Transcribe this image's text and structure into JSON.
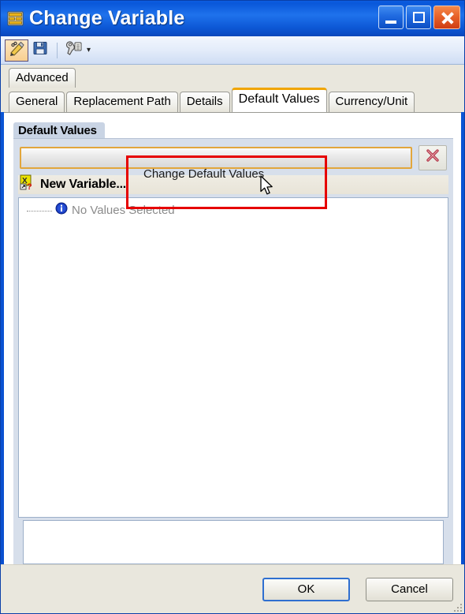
{
  "window": {
    "title": "Change Variable",
    "title_icon": "variable-window-icon",
    "controls": {
      "minimize": "Minimize",
      "maximize": "Maximize",
      "close": "Close"
    },
    "accent_titlebar": "#0d58d6",
    "accent_close": "#e8632a"
  },
  "toolbar": {
    "items": [
      {
        "name": "edit-pencil-icon",
        "label": "Edit",
        "active": true
      },
      {
        "name": "save-floppy-icon",
        "label": "Save",
        "active": false
      },
      {
        "name": "tools-wrench-icon",
        "label": "Tools",
        "active": false
      }
    ],
    "dropdown_arrow": "▾"
  },
  "tabs": {
    "row1": [
      {
        "label": "Advanced",
        "selected": false
      }
    ],
    "row2": [
      {
        "label": "General",
        "selected": false
      },
      {
        "label": "Replacement Path",
        "selected": false
      },
      {
        "label": "Details",
        "selected": false
      },
      {
        "label": "Default Values",
        "selected": true
      },
      {
        "label": "Currency/Unit",
        "selected": false
      }
    ],
    "selected_accent": "#f0a500"
  },
  "group": {
    "header": "Default Values",
    "input": {
      "value": "",
      "placeholder": ""
    },
    "delete_button": {
      "name": "delete-value-button",
      "icon": "red-x-icon",
      "color": "#b33a4a"
    },
    "new_variable": {
      "label": "New Variable...",
      "icon": "new-variable-icon"
    },
    "tree": {
      "rows": [
        {
          "label": "No Values Selected",
          "icon": "info-icon",
          "icon_color": "#1a3fc4"
        }
      ]
    }
  },
  "footer": {
    "ok_label": "OK",
    "cancel_label": "Cancel",
    "resize_grip": "resize-grip"
  },
  "annotation": {
    "highlight_color": "#e60000",
    "tooltip_text": "Change Default Values",
    "cursor": "arrow-cursor"
  }
}
